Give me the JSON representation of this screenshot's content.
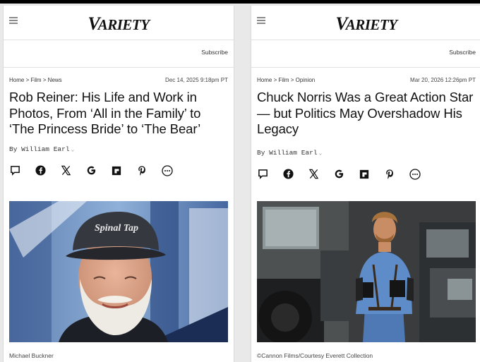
{
  "brand": {
    "logo_first": "V",
    "logo_rest": "ARIETY"
  },
  "left_article": {
    "subscribe": "Subscribe",
    "breadcrumb": "Home > Film > News",
    "date": "Dec 14, 2025 9:18pm PT",
    "headline": "Rob Reiner: His Life and Work in Photos, From ‘All in the Family’ to ‘The Princess Bride’ to ‘The Bear’",
    "byline": "By William Earl",
    "photo_cap_text": "Spinal Tap",
    "photo_credit": "Michael Buckner"
  },
  "right_article": {
    "subscribe": "Subscribe",
    "breadcrumb": "Home > Film > Opinion",
    "date": "Mar 20, 2026 12:26pm PT",
    "headline": "Chuck Norris Was a Great Action Star — but Politics May Overshadow His Legacy",
    "byline": "By William Earl",
    "photo_credit": "©Cannon Films/Courtesy Everett Collection"
  },
  "share_icons": [
    "comment-icon",
    "facebook-icon",
    "x-icon",
    "google-icon",
    "flipboard-icon",
    "pinterest-icon",
    "more-icon"
  ],
  "colors": {
    "text": "#111111",
    "meta": "#333333",
    "divider": "#e2e2e2",
    "background": "#e9e9e9"
  }
}
